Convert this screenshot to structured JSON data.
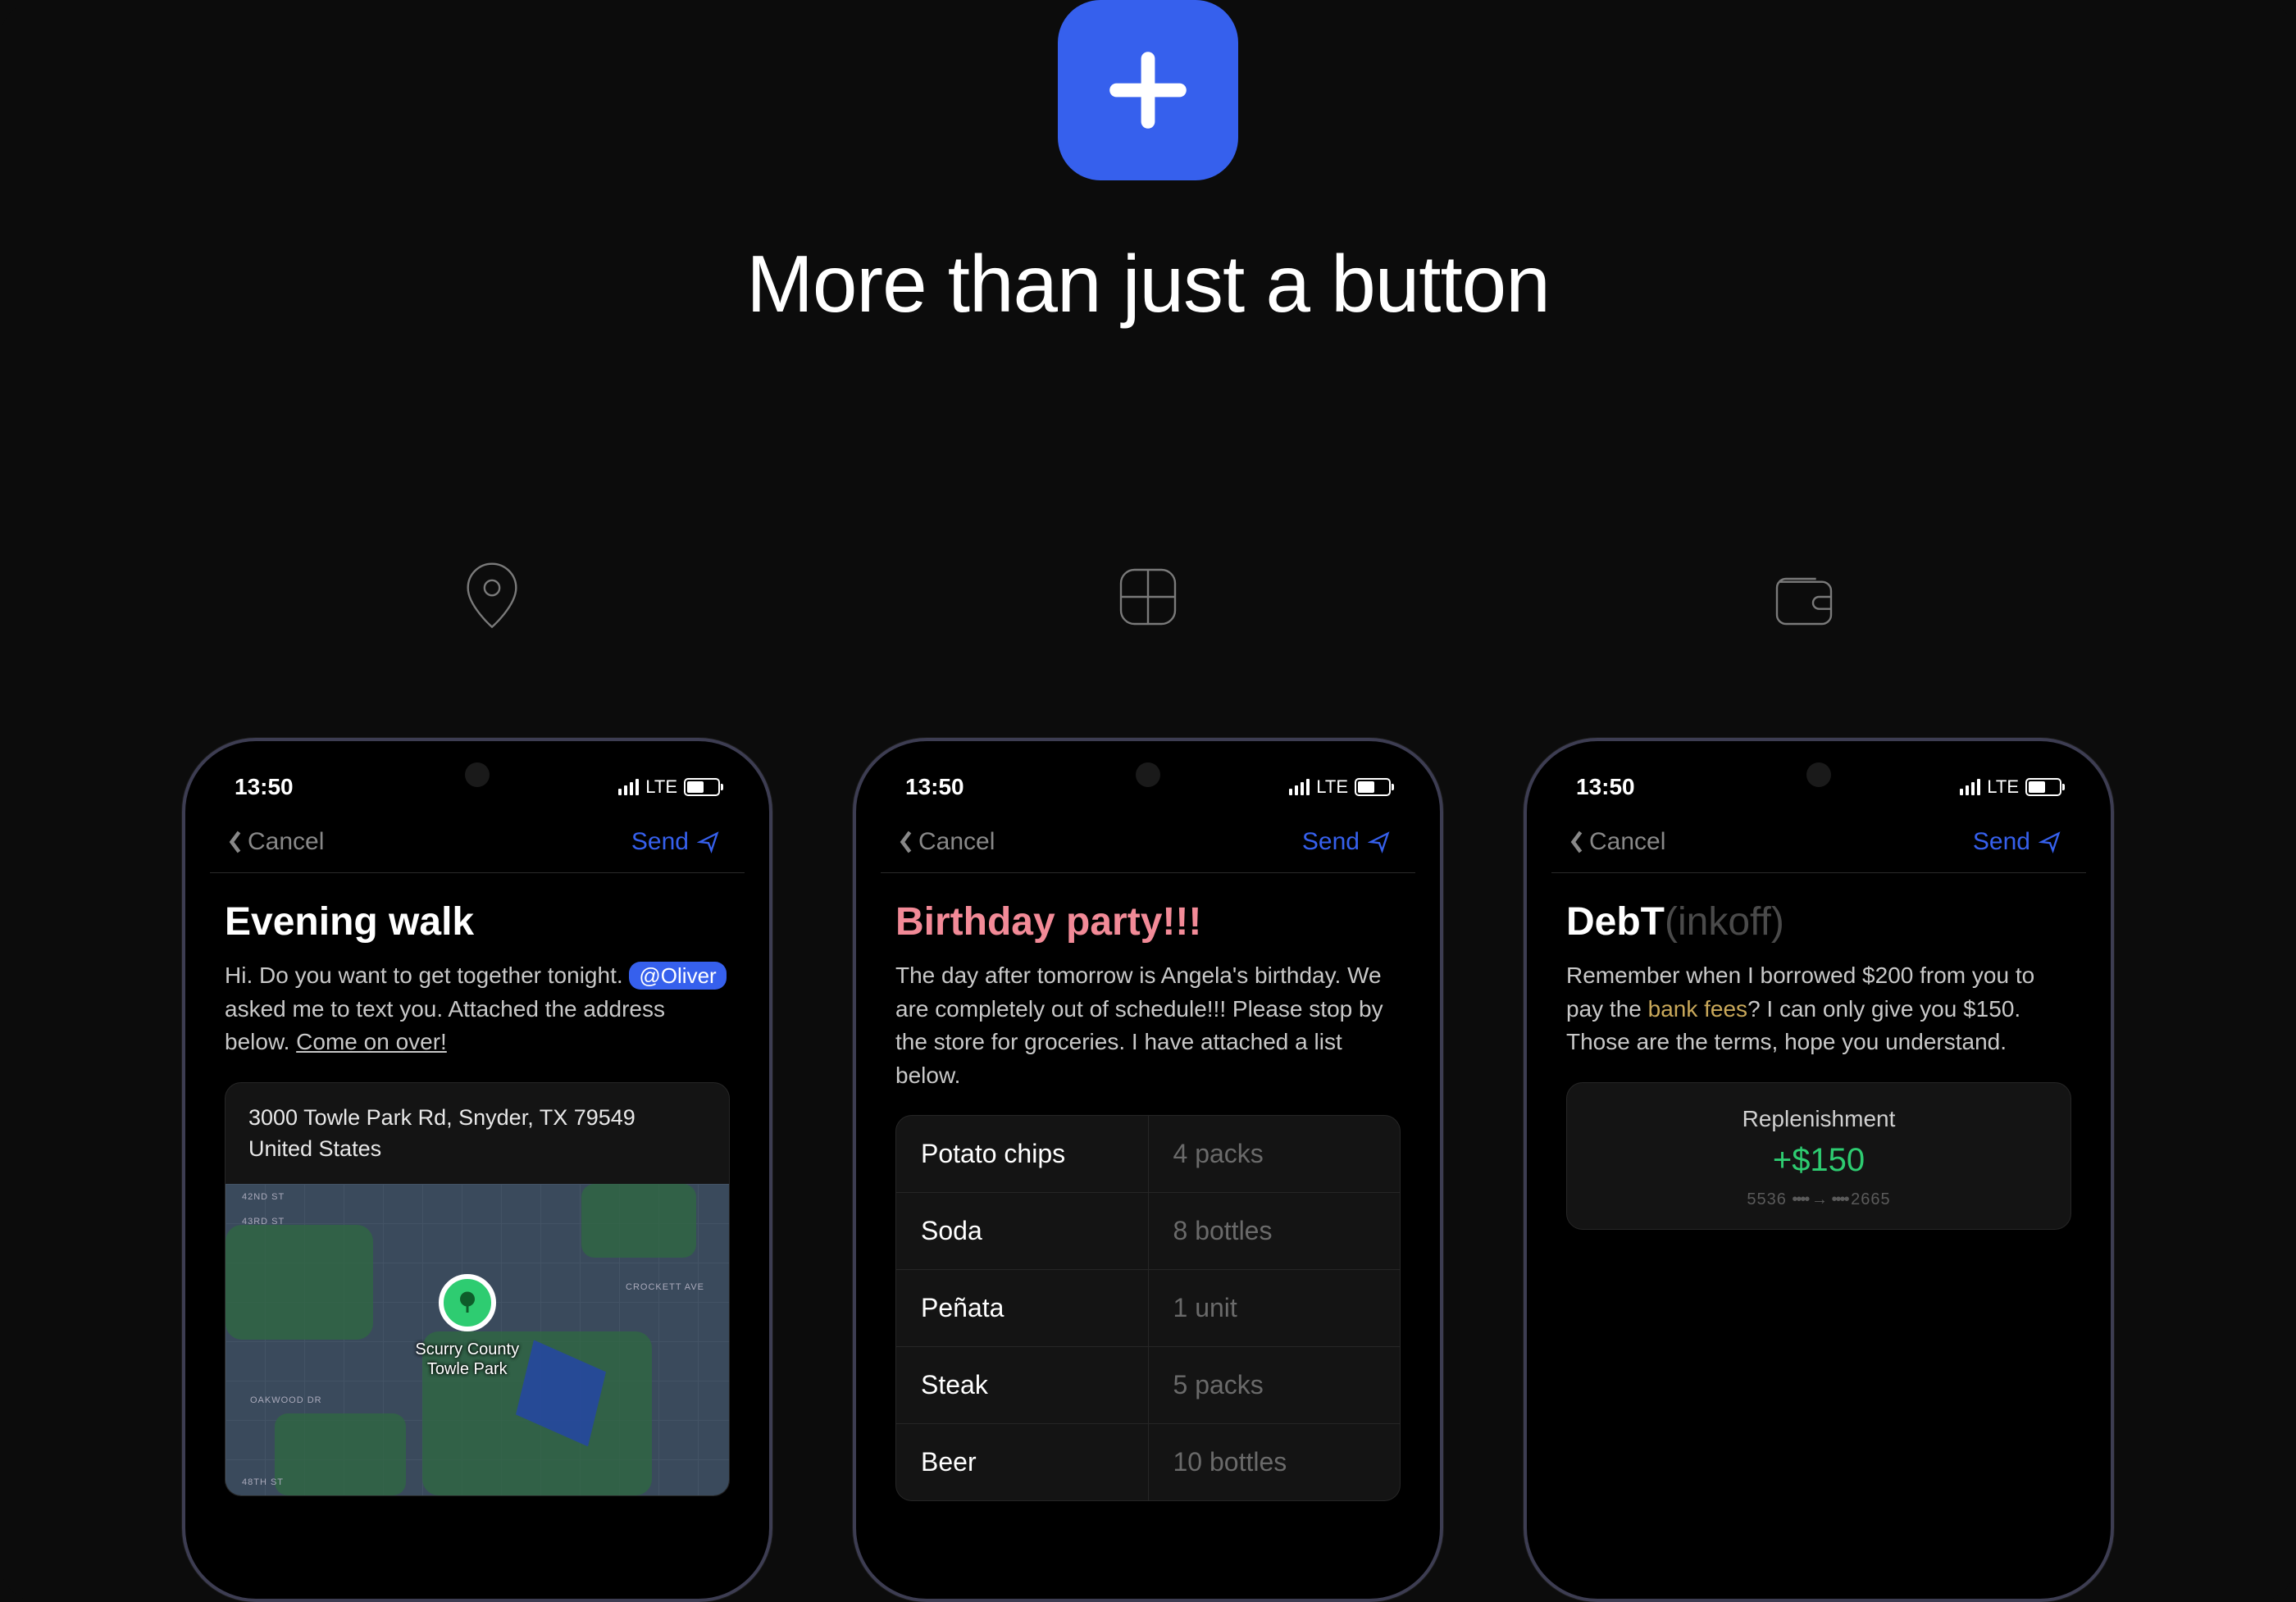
{
  "hero": {
    "title": "More than just a button"
  },
  "status": {
    "time": "13:50",
    "network": "LTE"
  },
  "nav": {
    "cancel": "Cancel",
    "send": "Send"
  },
  "phone1": {
    "title": "Evening walk",
    "body_pre": "Hi. Do you want to get together tonight. ",
    "mention": "@Oliver",
    "body_mid": " asked me to text you. Attached the address below. ",
    "body_cta": "Come on over!",
    "address_line1": "3000 Towle Park Rd, Snyder, TX  79549",
    "address_line2": "United States",
    "map_pin_label_1": "Scurry County",
    "map_pin_label_2": "Towle Park"
  },
  "phone2": {
    "title": "Birthday party!!!",
    "body": "The day after tomorrow is Angela's birthday. We are completely out of schedule!!! Please stop by the store for groceries. I have attached a list below.",
    "items": [
      {
        "name": "Potato chips",
        "qty": "4 packs"
      },
      {
        "name": "Soda",
        "qty": "8 bottles"
      },
      {
        "name": "Peñata",
        "qty": "1 unit"
      },
      {
        "name": "Steak",
        "qty": "5 packs"
      },
      {
        "name": "Beer",
        "qty": "10 bottles"
      }
    ]
  },
  "phone3": {
    "title_main": "DebT",
    "title_dim": "(inkoff)",
    "body_pre": "Remember when I borrowed $200 from you to pay the ",
    "body_link": "bank fees",
    "body_post": "? I can only give you $150. Those are the terms, hope you understand.",
    "wallet_label": "Replenishment",
    "wallet_amount": "+$150",
    "wallet_from": "5536",
    "wallet_to": "2665"
  }
}
